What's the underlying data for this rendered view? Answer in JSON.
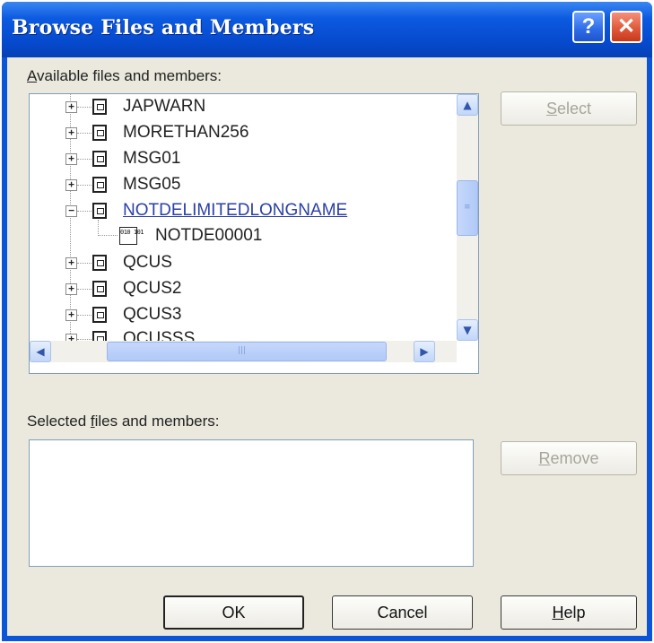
{
  "window": {
    "title": "Browse Files and Members",
    "help_glyph": "?",
    "close_glyph": "✕"
  },
  "available": {
    "label_accel": "A",
    "label_rest": "vailable files and members:",
    "tree": [
      {
        "label": "JAPWARN",
        "expander": "+"
      },
      {
        "label": "MORETHAN256",
        "expander": "+"
      },
      {
        "label": "MSG01",
        "expander": "+"
      },
      {
        "label": "MSG05",
        "expander": "+"
      },
      {
        "label": "NOTDELIMITEDLONGNAME",
        "expander": "−"
      },
      {
        "label": "NOTDE00001",
        "child": true,
        "icon_text": "010 101"
      },
      {
        "label": "QCUS",
        "expander": "+"
      },
      {
        "label": "QCUS2",
        "expander": "+"
      },
      {
        "label": "QCUS3",
        "expander": "+"
      },
      {
        "label": "QCUSSS",
        "expander": "+"
      }
    ]
  },
  "selected": {
    "label_pre": "Selected ",
    "label_accel": "f",
    "label_rest": "iles and members:"
  },
  "buttons": {
    "select_accel": "S",
    "select_rest": "elect",
    "remove_accel": "R",
    "remove_rest": "emove",
    "ok": "OK",
    "cancel": "Cancel",
    "help_accel": "H",
    "help_rest": "elp"
  },
  "icons": {
    "scroll_up": "▲",
    "scroll_down": "▼",
    "scroll_left": "◀",
    "scroll_right": "▶",
    "grip_v": "≡",
    "grip_h": "|||"
  }
}
